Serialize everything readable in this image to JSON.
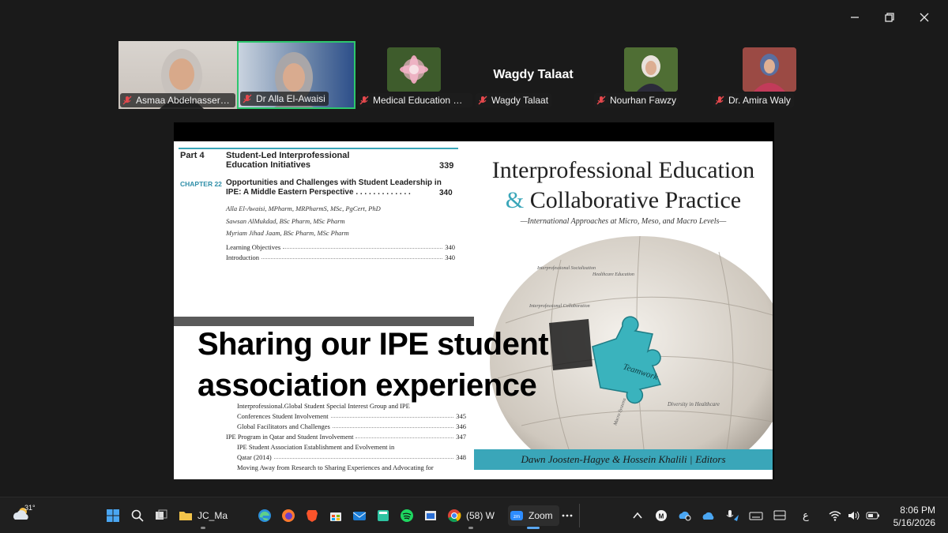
{
  "participants": [
    {
      "name": "Asmaa Abdelnasser (D..."
    },
    {
      "name": "Dr Alla El-Awaisi"
    },
    {
      "name": "Medical Education De..."
    },
    {
      "name": "Wagdy Talaat",
      "display_name": "Wagdy Talaat"
    },
    {
      "name": "Nourhan Fawzy"
    },
    {
      "name": "Dr. Amira Waly"
    }
  ],
  "toc": {
    "part_label": "Part 4",
    "part_title": "Student-Led Interprofessional Education Initiatives",
    "part_page": "339",
    "chapter_label": "CHAPTER 22",
    "chapter_title": "Opportunities and Challenges with Student Leadership in IPE: A Middle Eastern Perspective . . . . . . . . . . . . .",
    "chapter_page": "340",
    "authors": [
      "Alla El-Awaisi, MPharm, MRPharmS, MSc, PgCert, PhD",
      "Sawsan AlMukdad, BSc Pharm, MSc Pharm",
      "Myriam Jihad Jaam, BSc Pharm, MSc Pharm"
    ],
    "entries": [
      {
        "label": "Learning Objectives",
        "page": "340"
      },
      {
        "label": "Introduction",
        "page": "340"
      }
    ],
    "entries2": [
      {
        "label": "Interprofessional.Global Student Special Interest Group and IPE",
        "page": ""
      },
      {
        "label": "Conferences Student Involvement",
        "page": "345"
      },
      {
        "label": "Global Facilitators and Challenges",
        "page": "346"
      },
      {
        "label": "IPE Program in Qatar and Student Involvement",
        "page": "347"
      },
      {
        "label": "IPE Student Association Establishment and Evolvement in",
        "page": ""
      },
      {
        "label": "Qatar (2014)",
        "page": "348"
      },
      {
        "label": "Moving Away from Research to Sharing Experiences and Advocating for",
        "page": ""
      }
    ]
  },
  "overlay_title": "Sharing our IPE student association experience",
  "cover": {
    "title_line1": "Interprofessional Education",
    "title_amp": "&",
    "title_line2": "Collaborative Practice",
    "subtitle": "—International Approaches at Micro, Meso, and Macro Levels—",
    "puzzle_labels": [
      "Interprofessional Socialization",
      "Healthcare Education",
      "Interprofessional Collaboration",
      "Teamwork",
      "Diversity in Healthcare",
      "Macro Systems"
    ],
    "editors": "Dawn Joosten-Hagye & Hossein Khalili",
    "editors_suffix": "Editors"
  },
  "taskbar": {
    "weather_temp": "31°",
    "explorer_label": "JC_Ma",
    "chrome_label": "(58) W",
    "zoom_label": "Zoom",
    "time": "8:06 PM",
    "date": "5/16/2026",
    "lang": "ع"
  },
  "colors": {
    "accent_teal": "#3aa6b9",
    "active_speaker": "#2dc76d",
    "mic_off": "#e5484d"
  }
}
